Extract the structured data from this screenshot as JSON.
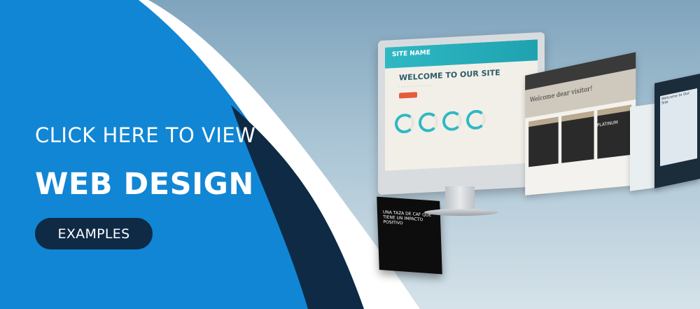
{
  "banner": {
    "headline_line1": "CLICK HERE TO VIEW",
    "headline_line2": "WEB DESIGN",
    "cta_label": "EXAMPLES"
  },
  "mockup": {
    "site_name": "SITE NAME",
    "welcome": "WELCOME TO OUR SITE",
    "visitor": "Welcome dear visitor!",
    "platinum": "PLATINUM",
    "welcome_small": "Welcome to Our Site",
    "dark_tagline": "UNA TAZA DE CAF QUE TIENE UN IMPACTO POSITIVO"
  },
  "colors": {
    "brand_blue": "#1186d4",
    "navy": "#0e2a45",
    "accent_teal": "#2fb8c4"
  }
}
